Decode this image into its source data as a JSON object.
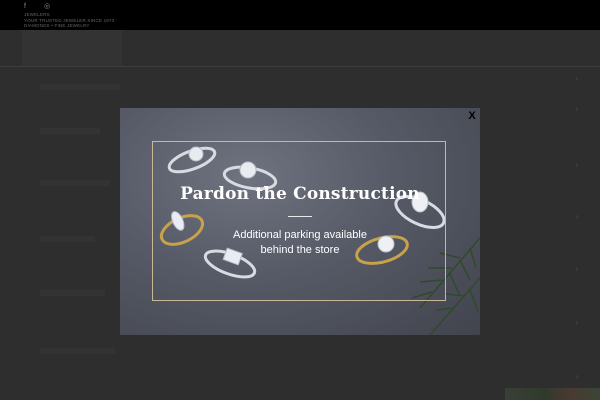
{
  "topbar": {
    "social": [
      {
        "icon": "facebook-icon",
        "glyph": "f"
      },
      {
        "icon": "instagram-icon",
        "glyph": "◎"
      }
    ],
    "brand_lines": [
      "JEWELERS",
      "YOUR TRUSTED JEWELER SINCE 1973",
      "DIAMONDS • FINE JEWELRY"
    ]
  },
  "colors": {
    "topbar_bg": "#000000",
    "modal_frame": "#c9b79a",
    "modal_text": "#ffffff",
    "ring_gold": "#c8a24a",
    "ring_silver": "#d8dbe2",
    "pine_green": "#2f4a2a"
  },
  "modal": {
    "title": "Pardon the Construction",
    "message_line1": "Additional parking available",
    "message_line2": "behind the store",
    "close_label": "X"
  }
}
